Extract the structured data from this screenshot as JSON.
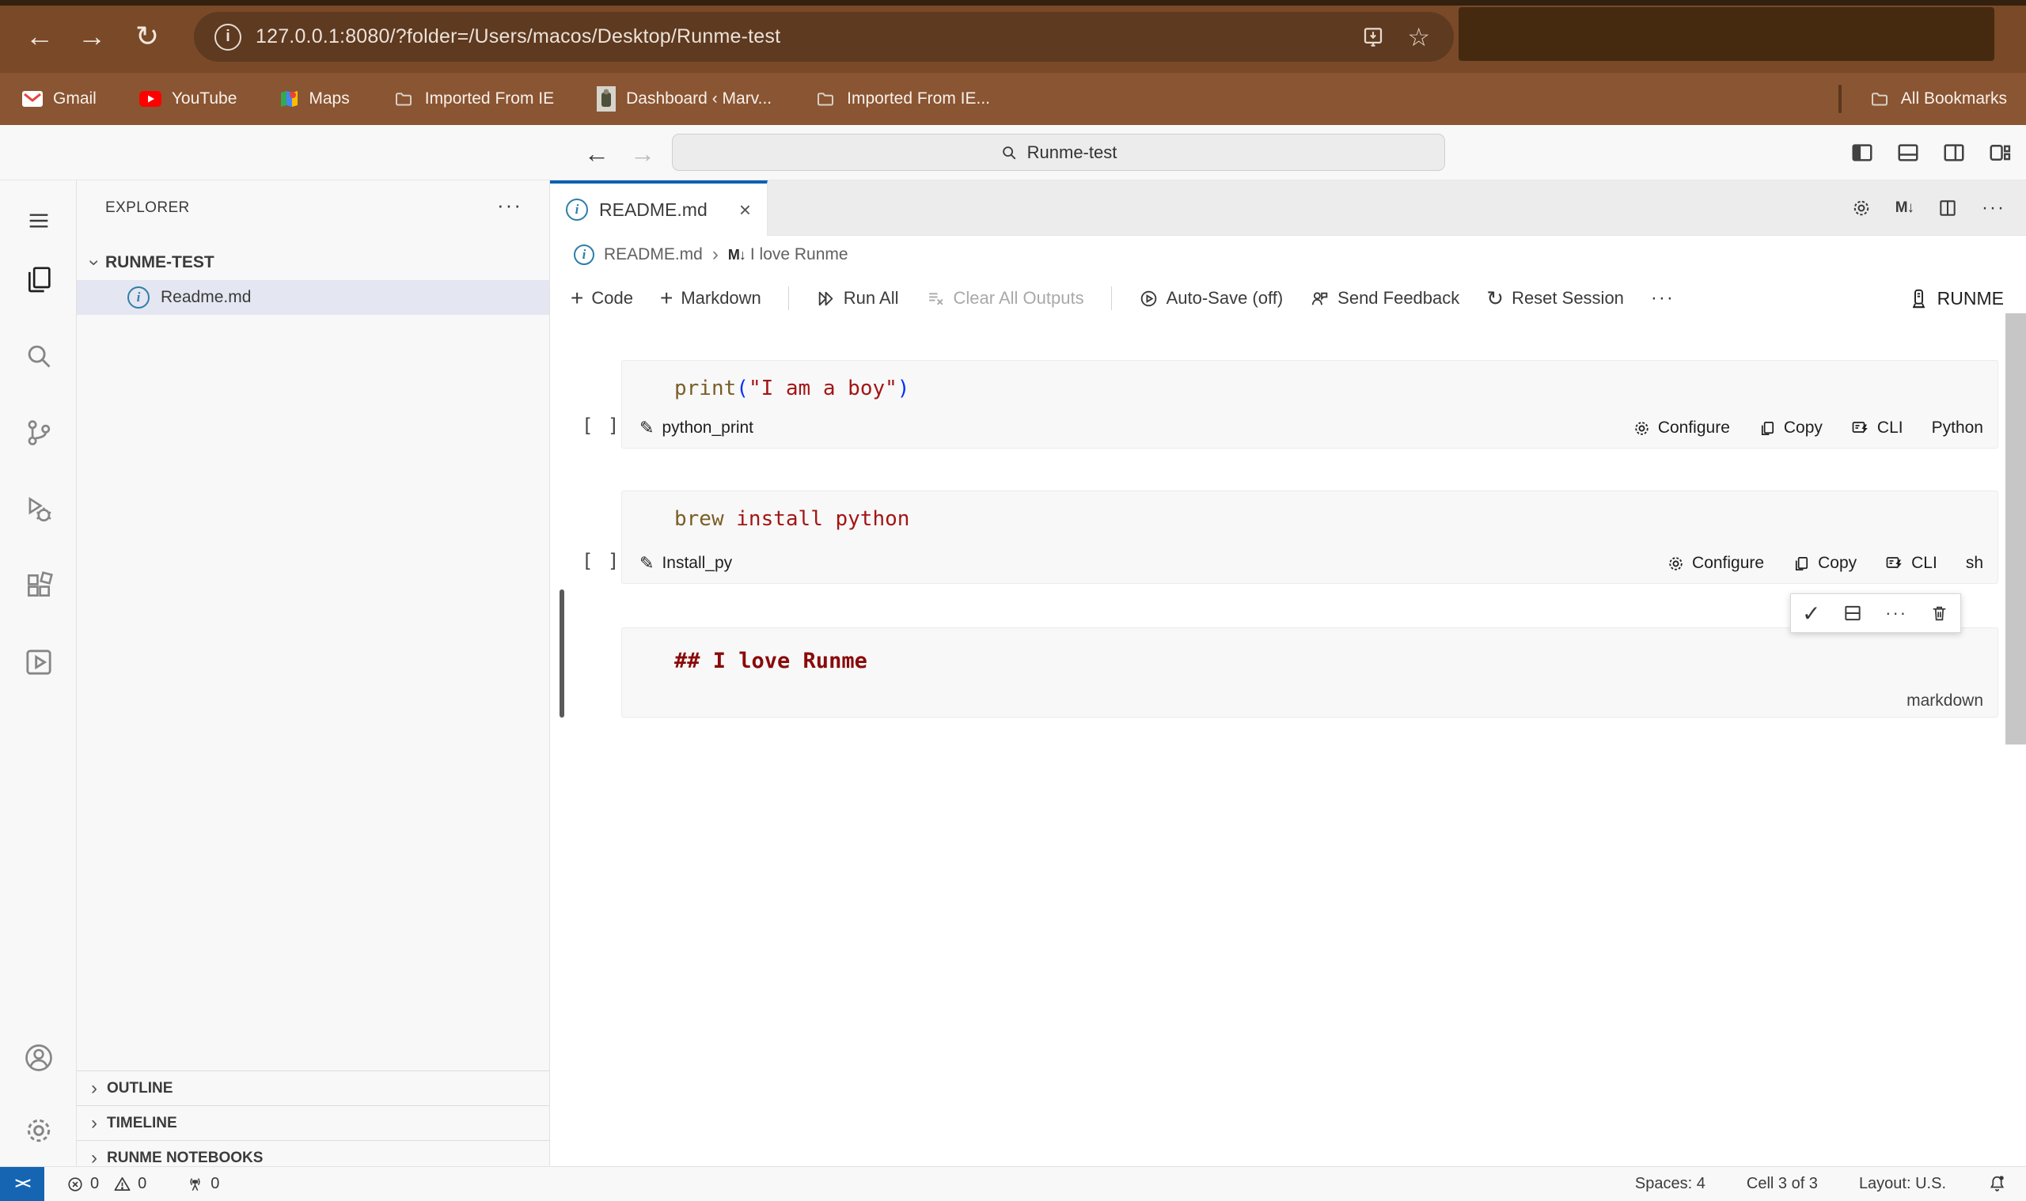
{
  "browser": {
    "url": "127.0.0.1:8080/?folder=/Users/macos/Desktop/Runme-test",
    "bookmarks": {
      "items": [
        {
          "label": "Gmail"
        },
        {
          "label": "YouTube"
        },
        {
          "label": "Maps"
        },
        {
          "label": "Imported From IE"
        },
        {
          "label": "Dashboard ‹ Marv..."
        },
        {
          "label": "Imported From IE..."
        }
      ],
      "all": "All Bookmarks"
    }
  },
  "titlebar": {
    "search": "Runme-test"
  },
  "sidebar": {
    "header": "EXPLORER",
    "root": "RUNME-TEST",
    "file": "Readme.md",
    "sections": [
      {
        "label": "OUTLINE"
      },
      {
        "label": "TIMELINE"
      },
      {
        "label": "RUNME NOTEBOOKS"
      }
    ]
  },
  "editor": {
    "tab": "README.md",
    "breadcrumb": {
      "file": "README.md",
      "sep": "›",
      "badge": "M↓",
      "heading": "I love Runme"
    },
    "toolbar": {
      "code": "Code",
      "markdown": "Markdown",
      "run_all": "Run All",
      "clear": "Clear All Outputs",
      "autosave": "Auto-Save (off)",
      "feedback": "Send Feedback",
      "reset": "Reset Session",
      "more": "···",
      "brand": "RUNME"
    },
    "cells": [
      {
        "exec": "[ ]",
        "code": {
          "fn": "print",
          "p1": "(",
          "str": "\"I am a boy\"",
          "p2": ")"
        },
        "name": "python_print",
        "configure": "Configure",
        "copy": "Copy",
        "cli": "CLI",
        "lang": "Python"
      },
      {
        "exec": "[ ]",
        "code": {
          "fn": "brew",
          "str": " install python"
        },
        "name": "Install_py",
        "configure": "Configure",
        "copy": "Copy",
        "cli": "CLI",
        "lang": "sh"
      },
      {
        "text": "## I love Runme",
        "lang": "markdown"
      }
    ]
  },
  "statusbar": {
    "remote": "><",
    "errors": "0",
    "warnings": "0",
    "ports": "0",
    "spaces": "Spaces: 4",
    "cell": "Cell 3 of 3",
    "layout": "Layout: U.S."
  },
  "icons": {
    "back": "←",
    "forward": "→",
    "reload": "↻",
    "star": "☆",
    "info": "i",
    "close": "×",
    "more": "···",
    "plus": "+",
    "pencil": "✎",
    "chevron": "›",
    "reset": "↻",
    "check": "✓"
  },
  "colors": {
    "chrome": "#7a4928",
    "chrome_dark": "#452a10",
    "url_pill": "#5e3a21",
    "bookmarks_bar": "#8a5533",
    "accent_blue": "#0b62b4",
    "remote_blue": "#1565b3",
    "selection": "#e4e6f1",
    "token_keyword": "#795E26",
    "token_string": "#A31515",
    "token_bracket": "#0431fa",
    "md_heading": "#8a0a0a"
  }
}
